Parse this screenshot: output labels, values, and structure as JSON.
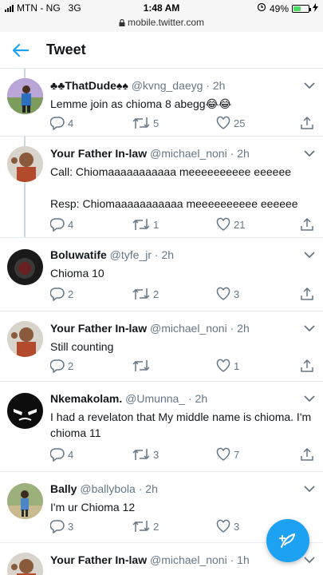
{
  "status_bar": {
    "carrier": "MTN - NG",
    "network": "3G",
    "time": "1:48 AM",
    "battery": "49%",
    "battery_level": 0.49,
    "url": "mobile.twitter.com"
  },
  "header": {
    "title": "Tweet"
  },
  "colors": {
    "accent": "#1da1f2",
    "muted": "#657786",
    "text": "#14171a",
    "separator": "#e6ecf0"
  },
  "tweets": [
    {
      "name": "♣♣ThatDude♠♠",
      "handle": "@kvng_daeyg",
      "dot": "·",
      "time": "2h",
      "text": "Lemme join as chioma 8 abegg😂😂",
      "replies": "4",
      "retweets": "5",
      "likes": "25"
    },
    {
      "name": "Your Father In-law",
      "handle": "@michael_noni",
      "dot": "·",
      "time": "2h",
      "text": "Call: Chiomaaaaaaaaaaa meeeeeeeeee eeeeee\n\nResp: Chiomaaaaaaaaaaa meeeeeeeeee eeeeee",
      "replies": "4",
      "retweets": "1",
      "likes": "21"
    },
    {
      "name": "Boluwatife",
      "handle": "@tyfe_jr",
      "dot": "·",
      "time": "2h",
      "text": "Chioma 10",
      "replies": "2",
      "retweets": "2",
      "likes": "3"
    },
    {
      "name": "Your Father In-law",
      "handle": "@michael_noni",
      "dot": "·",
      "time": "2h",
      "text": "Still counting",
      "replies": "2",
      "retweets": "",
      "likes": "1"
    },
    {
      "name": "Nkemakolam.",
      "handle": "@Umunna_",
      "dot": "·",
      "time": "2h",
      "text": "I had a revelaton that My middle name is chioma. I'm chioma 11",
      "replies": "4",
      "retweets": "3",
      "likes": "7"
    },
    {
      "name": "Bally",
      "handle": "@ballybola",
      "dot": "·",
      "time": "2h",
      "text": "I'm ur Chioma 12",
      "replies": "3",
      "retweets": "2",
      "likes": "3"
    },
    {
      "name": "Your Father In-law",
      "handle": "@michael_noni",
      "dot": "·",
      "time": "1h",
      "text": "",
      "replies": "",
      "retweets": "",
      "likes": ""
    }
  ],
  "icons": [
    "back-arrow-icon",
    "chevron-down-icon",
    "reply-icon",
    "retweet-icon",
    "like-icon",
    "share-icon",
    "compose-icon",
    "lock-icon",
    "alarm-icon",
    "charging-icon"
  ]
}
